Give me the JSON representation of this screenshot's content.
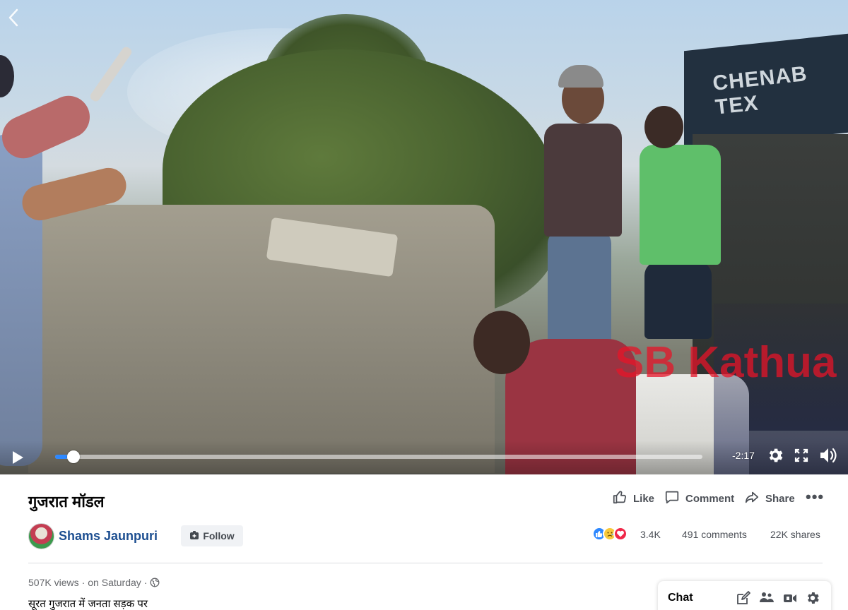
{
  "video": {
    "back_icon": "chevron-left-icon",
    "shop_sign_text": "CHENAB TEX",
    "watermark_text": "SB Kathua",
    "controls": {
      "play_icon": "play-icon",
      "progress_fraction": 0.02,
      "time_remaining": "-2:17",
      "settings_icon": "gear-icon",
      "fullscreen_icon": "fullscreen-icon",
      "volume_icon": "volume-icon"
    }
  },
  "post": {
    "title": "गुजरात मॉडल",
    "actions": {
      "like_label": "Like",
      "comment_label": "Comment",
      "share_label": "Share",
      "more_label": "•••"
    },
    "author": {
      "name": "Shams Jaunpuri",
      "follow_label": "Follow"
    },
    "stats": {
      "reactions_count": "3.4K",
      "reaction_icons": [
        "like-icon",
        "sad-icon",
        "love-icon"
      ],
      "comments": "491 comments",
      "shares": "22K shares"
    },
    "meta": {
      "views": "507K views",
      "separator": "·",
      "time": "on Saturday",
      "separator2": "·",
      "privacy_icon": "globe-icon"
    },
    "description": "सूरत गुजरात में जनता सड़क पर"
  },
  "chat": {
    "label": "Chat",
    "icons": [
      "compose-icon",
      "group-icon",
      "video-call-icon",
      "gear-icon"
    ]
  },
  "colors": {
    "accent_blue": "#2d88ff",
    "author_blue": "#1d4f91",
    "watermark_red": "#e61428"
  }
}
